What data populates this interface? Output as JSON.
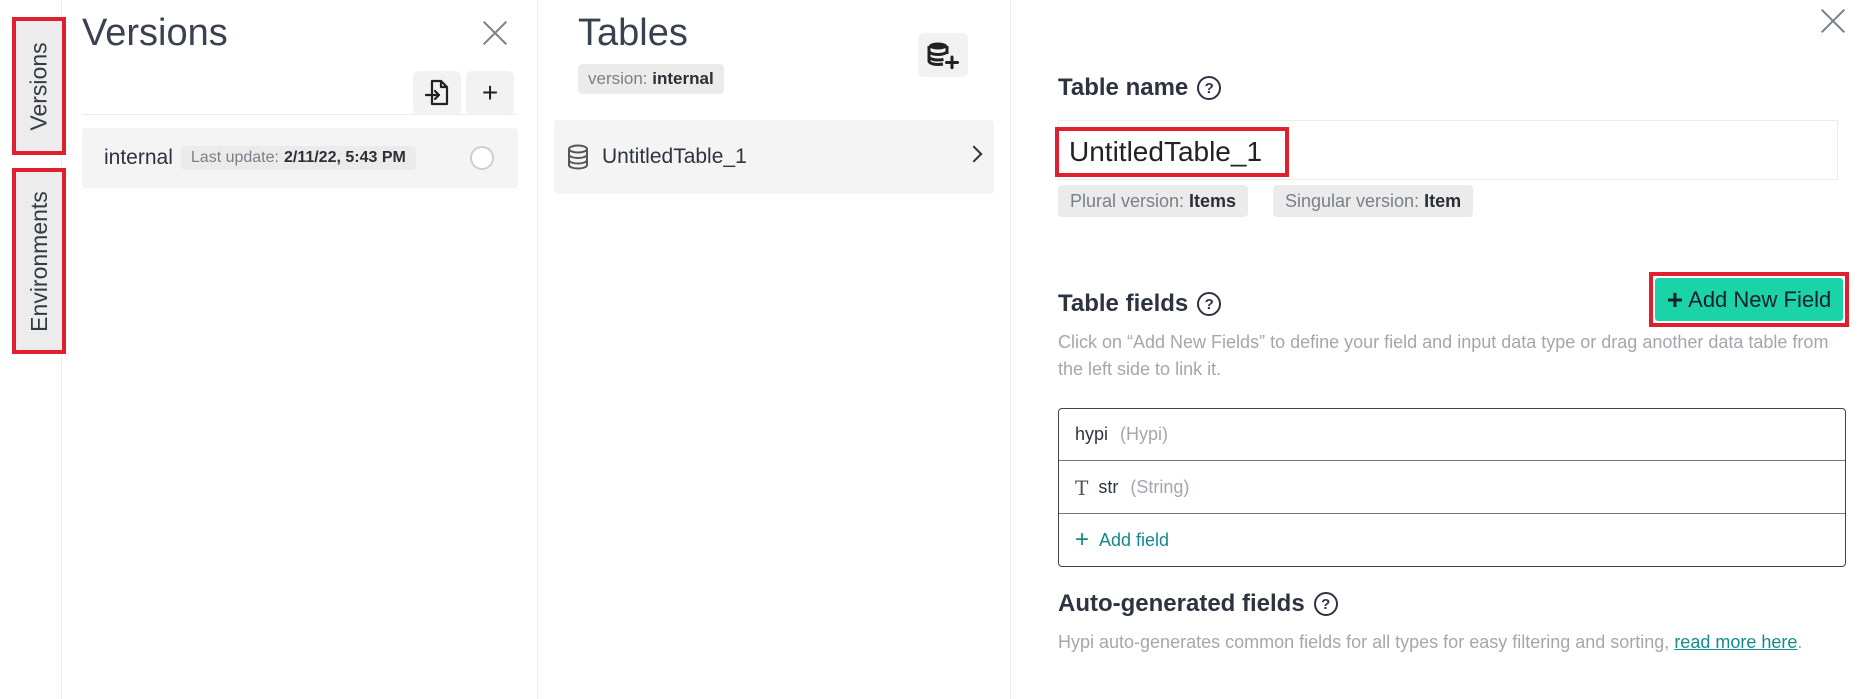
{
  "rail": {
    "versions_tab": "Versions",
    "environments_tab": "Environments"
  },
  "versions_panel": {
    "title": "Versions",
    "items": [
      {
        "name": "internal",
        "last_update_label": "Last update:",
        "last_update_value": "2/11/22, 5:43 PM"
      }
    ]
  },
  "tables_panel": {
    "title": "Tables",
    "version_label": "version:",
    "version_value": "internal",
    "tables": [
      {
        "name": "UntitledTable_1"
      }
    ]
  },
  "detail": {
    "table_name_label": "Table name",
    "table_name_value": "UntitledTable_1",
    "plural_label": "Plural version:",
    "plural_value": "Items",
    "singular_label": "Singular version:",
    "singular_value": "Item",
    "table_fields_label": "Table fields",
    "add_new_field": "Add New Field",
    "fields_hint": "Click on “Add New Fields” to define your field and input data type or drag another data table from the left side to link it.",
    "fields": [
      {
        "name": "hypi",
        "type": "(Hypi)",
        "icon": "none"
      },
      {
        "name": "str",
        "type": "(String)",
        "icon": "text-type-icon"
      }
    ],
    "add_field": "Add field",
    "auto_fields_label": "Auto-generated fields",
    "auto_fields_text": "Hypi auto-generates common fields for all types for easy filtering and sorting, ",
    "read_more": "read more here",
    "period": "."
  },
  "colors": {
    "accent_green": "#1ad4a8",
    "highlight_red": "#e0202e",
    "link_teal": "#148a8a"
  }
}
